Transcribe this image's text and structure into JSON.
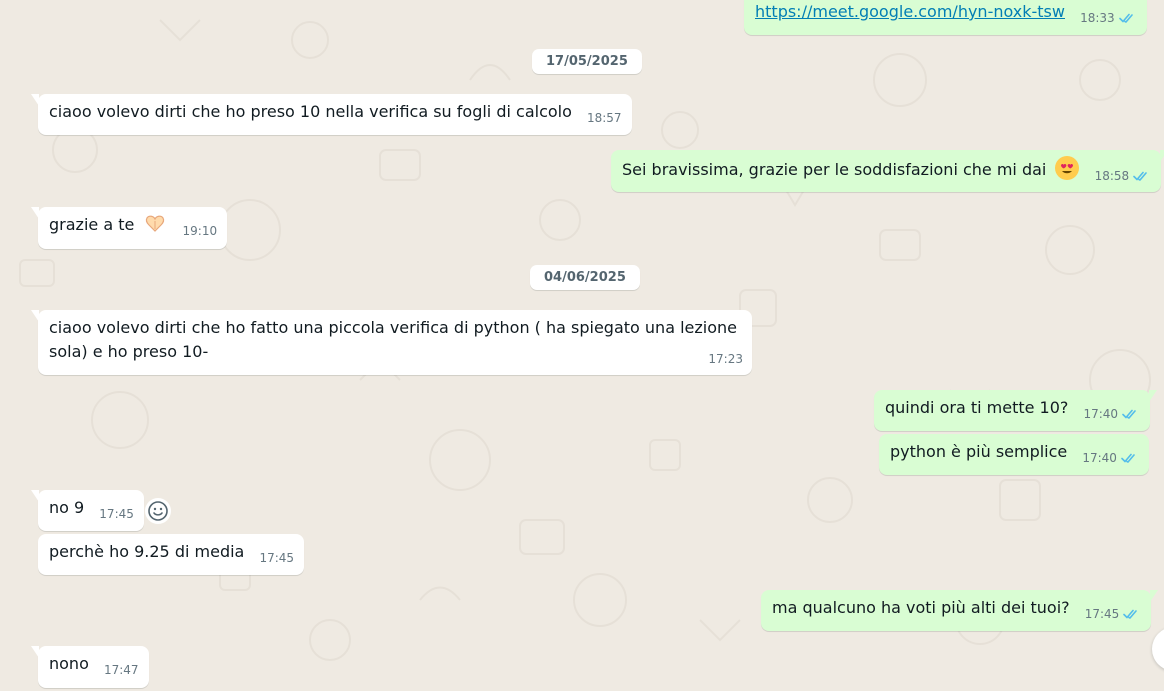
{
  "messages": [
    {
      "text": "https://meet.google.com/hyn-noxk-tsw",
      "time": "18:33",
      "dir": "out"
    },
    {
      "text": "ciaoo volevo dirti che ho preso 10 nella verifica su fogli di calcolo",
      "time": "18:57",
      "dir": "in"
    },
    {
      "text": "Sei bravissima, grazie per le soddisfazioni che mi dai",
      "time": "18:58",
      "dir": "out"
    },
    {
      "text": "grazie a te",
      "time": "19:10",
      "dir": "in"
    },
    {
      "text_line1": "ciaoo volevo dirti che ho fatto una piccola verifica di python ( ha spiegato una lezione",
      "text_line2": "sola) e ho preso 10-",
      "time": "17:23",
      "dir": "in"
    },
    {
      "text": "quindi ora ti mette 10?",
      "time": "17:40",
      "dir": "out"
    },
    {
      "text": "python è più semplice",
      "time": "17:40",
      "dir": "out"
    },
    {
      "text": "no 9",
      "time": "17:45",
      "dir": "in"
    },
    {
      "text": "perchè ho 9.25 di media",
      "time": "17:45",
      "dir": "in"
    },
    {
      "text": "ma qualcuno ha voti più alti dei tuoi?",
      "time": "17:45",
      "dir": "out"
    },
    {
      "text": "nono",
      "time": "17:47",
      "dir": "in"
    }
  ],
  "dates": [
    "17/05/2025",
    "04/06/2025"
  ],
  "icons": {
    "read_ticks": "double-check-icon",
    "heart_eyes": "heart-eyes-emoji",
    "heart_hands": "heart-hands-emoji",
    "react": "smiley-react-icon"
  },
  "colors": {
    "background": "#efeae2",
    "incoming": "#ffffff",
    "outgoing": "#d9fdd3",
    "ticks": "#53bdeb",
    "link": "#027eb5"
  }
}
